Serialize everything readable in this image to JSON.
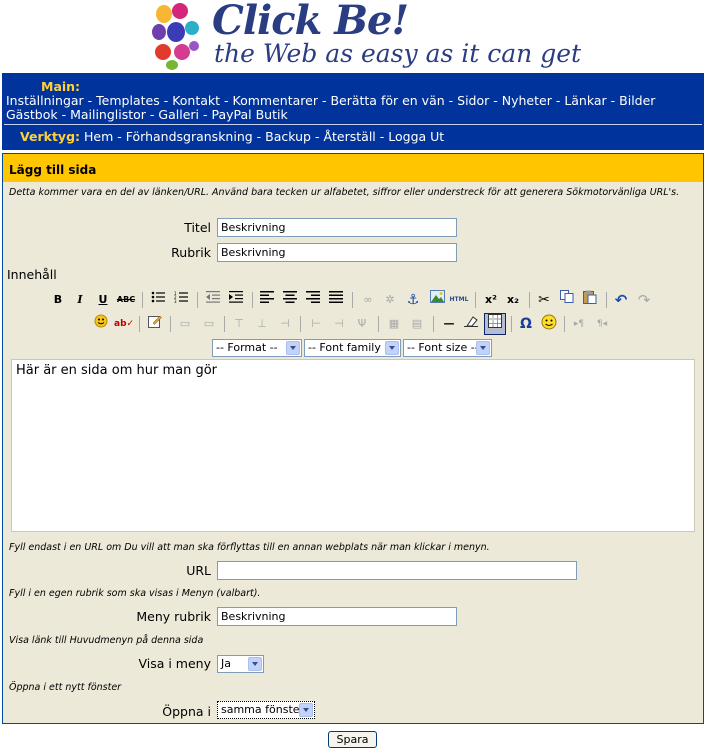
{
  "brand": {
    "title": "Click Be!",
    "tagline": "the Web as easy as it can get"
  },
  "nav": {
    "main_label": "Main:",
    "main_links": [
      "Inställningar",
      "Templates",
      "Kontakt",
      "Kommentarer",
      "Berätta för en vän",
      "Sidor",
      "Nyheter",
      "Länkar",
      "Bilder",
      "Gästbok",
      "Mailinglistor",
      "Galleri",
      "PayPal Butik"
    ],
    "tools_label": "Verktyg:",
    "tools_links": [
      "Hem",
      "Förhandsgranskning",
      "Backup",
      "Återställ",
      "Logga Ut"
    ]
  },
  "form": {
    "title": "Lägg till sida",
    "hint_intro": "Detta kommer vara en del av länken/URL. Använd bara tecken ur alfabetet, siffror eller understreck för att generera Sökmotorvänliga URL's.",
    "titel_label": "Titel",
    "titel_value": "Beskrivning",
    "rubrik_label": "Rubrik",
    "rubrik_value": "Beskrivning",
    "content_label": "Innehåll",
    "editor_text": "Här är en sida om hur man gör",
    "format_select": "-- Format --",
    "font_family_select": "-- Font family --",
    "font_size_select": "-- Font size --",
    "hint_url": "Fyll endast i en URL om Du vill att man ska förflyttas till en annan webplats när man klickar i menyn.",
    "url_label": "URL",
    "url_value": "",
    "hint_menu": "Fyll i en egen rubrik som ska visas i Menyn (valbart).",
    "menu_label": "Meny rubrik",
    "menu_value": "Beskrivning",
    "hint_show": "Visa länk till Huvudmenyn på denna sida",
    "show_label": "Visa i meny",
    "show_value": "Ja",
    "hint_window": "Öppna i ett nytt fönster",
    "window_label": "Öppna i",
    "window_value": "samma fönster",
    "save_label": "Spara"
  },
  "toolbar_text": {
    "bold": "B",
    "italic": "I",
    "underline": "U",
    "strike": "ABC",
    "html": "HTML",
    "sup": "x²",
    "sub": "x₂",
    "omega": "Ω",
    "pilcrow_ltr": "▸¶",
    "pilcrow_rtl": "¶◂"
  },
  "colors": {
    "nav_bg": "#00349c",
    "nav_label": "#ffd23a",
    "panel_bg": "#ece9d8",
    "panel_title_bg": "#ffc600",
    "brand": "#2a3c82"
  }
}
